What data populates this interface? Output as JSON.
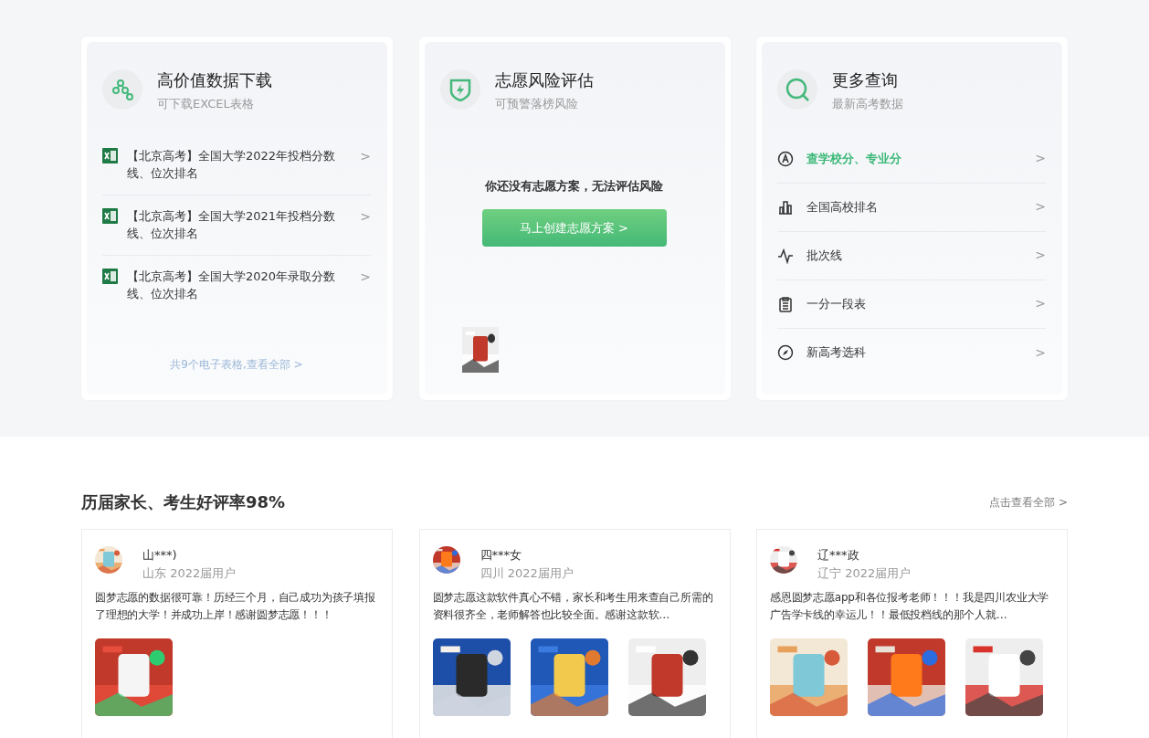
{
  "feature_cards": [
    {
      "kind": "downloads",
      "title": "高价值数据下载",
      "subtitle": "可下载EXCEL表格",
      "items": [
        {
          "text": "【北京高考】全国大学2022年投档分数线、位次排名",
          "arrow": ">"
        },
        {
          "text": "【北京高考】全国大学2021年投档分数线、位次排名",
          "arrow": ">"
        },
        {
          "text": "【北京高考】全国大学2020年录取分数线、位次排名",
          "arrow": ">"
        }
      ],
      "footer_link": "共9个电子表格,查看全部 >"
    },
    {
      "kind": "risk",
      "title": "志愿风险评估",
      "subtitle": "可预警落榜风险",
      "message": "你还没有志愿方案，无法评估风险",
      "button": "马上创建志愿方案 >"
    },
    {
      "kind": "queries",
      "title": "更多查询",
      "subtitle": "最新高考数据",
      "items": [
        {
          "text": "查学校分、专业分",
          "arrow": ">",
          "selected": true
        },
        {
          "text": "全国高校排名",
          "arrow": ">",
          "selected": false
        },
        {
          "text": "批次线",
          "arrow": ">",
          "selected": false
        },
        {
          "text": "一分一段表",
          "arrow": ">",
          "selected": false
        },
        {
          "text": "新高考选科",
          "arrow": ">",
          "selected": false
        }
      ]
    }
  ],
  "reviews": {
    "title": "历届家长、考生好评率98%",
    "view_all": "点击查看全部 >",
    "items": [
      {
        "name": "山***)",
        "meta": "山东 2022届用户",
        "text": "圆梦志愿的数据很可靠！历经三个月，自己成功为孩子填报了理想的大学！并成功上岸！感谢圆梦志愿！！！"
      },
      {
        "name": "四***女",
        "meta": "四川 2022届用户",
        "text": "圆梦志愿这款软件真心不错，家长和考生用来查自己所需的资料很齐全，老师解答也比较全面。感谢这款软…"
      },
      {
        "name": "辽***政",
        "meta": "辽宁 2022届用户",
        "text": "感恩圆梦志愿app和各位报考老师！！！我是四川农业大学广告学卡线的幸运儿！！最低投档线的那个人就…"
      }
    ]
  }
}
